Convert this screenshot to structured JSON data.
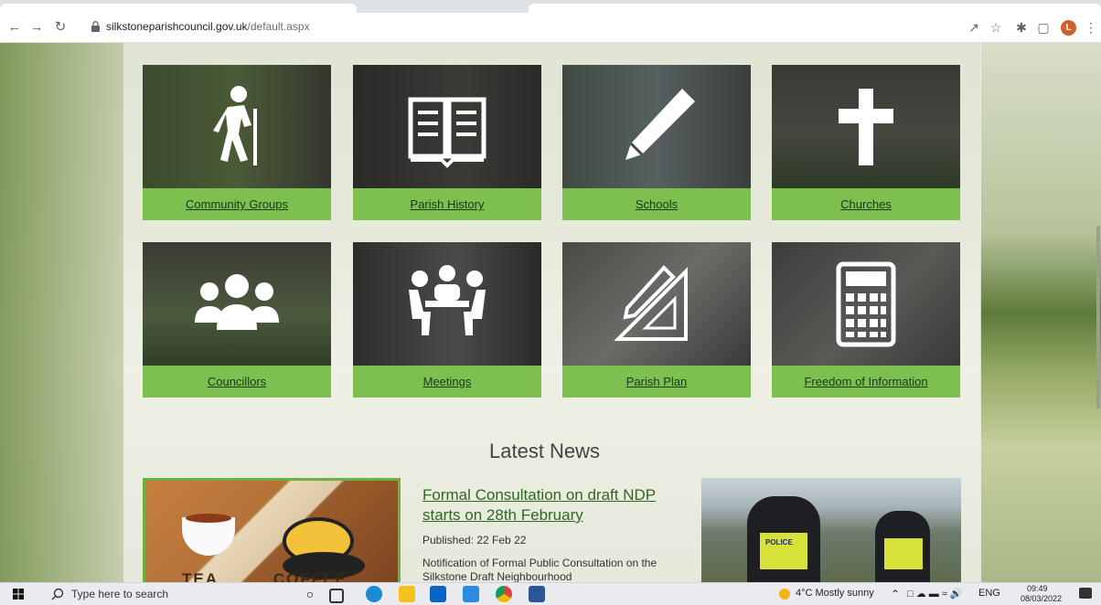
{
  "browser": {
    "url_host": "silkstoneparishcouncil.gov.uk",
    "url_path": "/default.aspx",
    "profile_initial": "L"
  },
  "tiles": [
    {
      "label": "Community Groups",
      "icon": "hiker-icon"
    },
    {
      "label": "Parish History",
      "icon": "open-book-icon"
    },
    {
      "label": "Schools",
      "icon": "pencil-icon"
    },
    {
      "label": "Churches",
      "icon": "cross-icon"
    },
    {
      "label": "Councillors",
      "icon": "people-group-icon"
    },
    {
      "label": "Meetings",
      "icon": "meeting-table-icon"
    },
    {
      "label": "Parish Plan",
      "icon": "ruler-pencil-icon"
    },
    {
      "label": "Freedom of Information",
      "icon": "calculator-icon"
    }
  ],
  "news": {
    "heading": "Latest News",
    "items": [
      {
        "image_text": "TEA         COFFEE"
      },
      {
        "headline": "Formal Consultation on draft NDP starts on 28th February",
        "published": "Published: 22 Feb 22",
        "summary": "Notification of Formal Public Consultation on the Silkstone Draft Neighbourhood"
      },
      {
        "image_text": "POLICE"
      }
    ]
  },
  "taskbar": {
    "search_placeholder": "Type here to search",
    "weather": "4°C  Mostly sunny",
    "language": "ENG",
    "time": "09:49",
    "date": "08/03/2022"
  },
  "colors": {
    "tile_caption": "#7ec04f",
    "news_link": "#2d6a1f"
  }
}
